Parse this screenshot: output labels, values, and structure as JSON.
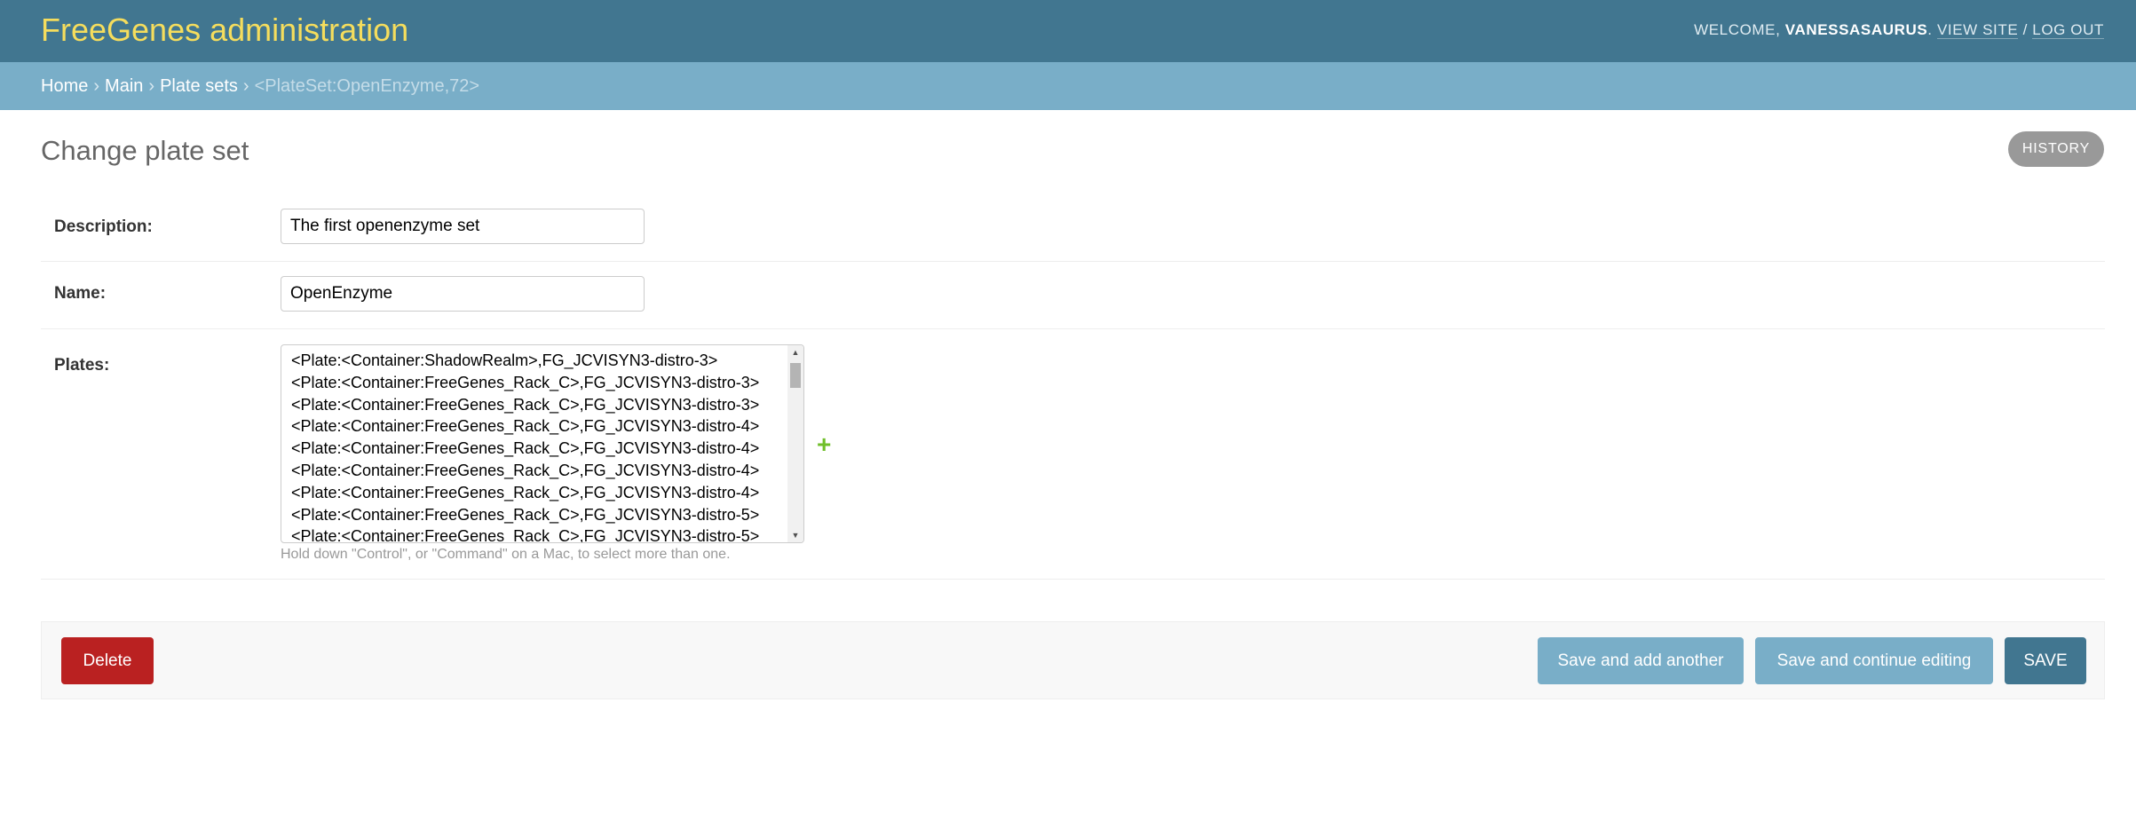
{
  "header": {
    "site_name": "FreeGenes administration",
    "welcome_label": "WELCOME,",
    "username": "VANESSASAURUS",
    "view_site": "VIEW SITE",
    "separator": "/",
    "log_out": "LOG OUT"
  },
  "breadcrumbs": {
    "items": [
      "Home",
      "Main",
      "Plate sets"
    ],
    "separator": "›",
    "current": "<PlateSet:OpenEnzyme,72>"
  },
  "page": {
    "title": "Change plate set",
    "history_button": "HISTORY"
  },
  "form": {
    "description": {
      "label": "Description:",
      "value": "The first openenzyme set"
    },
    "name": {
      "label": "Name:",
      "value": "OpenEnzyme"
    },
    "plates": {
      "label": "Plates:",
      "options": [
        "<Plate:<Container:ShadowRealm>,FG_JCVISYN3-distro-3>",
        "<Plate:<Container:FreeGenes_Rack_C>,FG_JCVISYN3-distro-3>",
        "<Plate:<Container:FreeGenes_Rack_C>,FG_JCVISYN3-distro-3>",
        "<Plate:<Container:FreeGenes_Rack_C>,FG_JCVISYN3-distro-4>",
        "<Plate:<Container:FreeGenes_Rack_C>,FG_JCVISYN3-distro-4>",
        "<Plate:<Container:FreeGenes_Rack_C>,FG_JCVISYN3-distro-4>",
        "<Plate:<Container:FreeGenes_Rack_C>,FG_JCVISYN3-distro-4>",
        "<Plate:<Container:FreeGenes_Rack_C>,FG_JCVISYN3-distro-5>",
        "<Plate:<Container:FreeGenes_Rack_C>,FG_JCVISYN3-distro-5>"
      ],
      "add_icon": "plus-icon",
      "help_text": "Hold down \"Control\", or \"Command\" on a Mac, to select more than one."
    }
  },
  "actions": {
    "delete": "Delete",
    "save_add_another": "Save and add another",
    "save_continue": "Save and continue editing",
    "save": "SAVE"
  },
  "colors": {
    "header_bg": "#417690",
    "breadcrumbs_bg": "#79aec8",
    "site_name": "#f5dd5d",
    "delete_button": "#ba2121",
    "secondary_button": "#79aec8",
    "primary_button": "#417690",
    "add_icon": "#70bf2b"
  }
}
